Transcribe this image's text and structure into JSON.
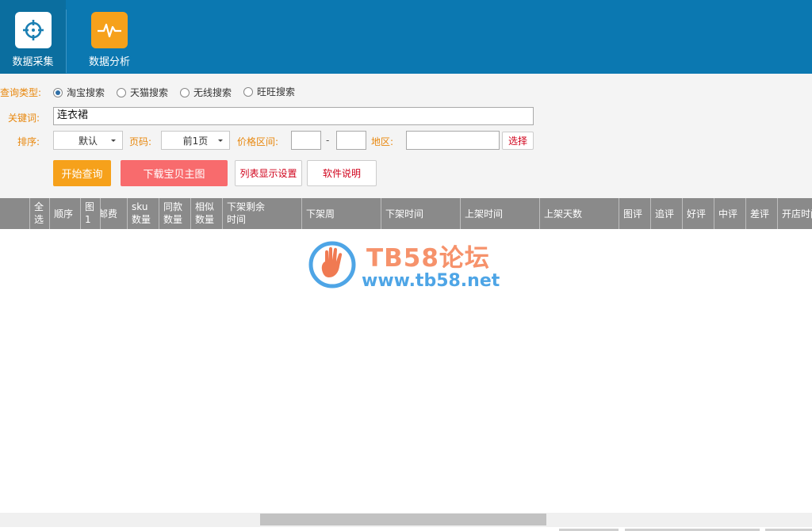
{
  "nav": {
    "collect_label": "数据采集",
    "analysis_label": "数据分析"
  },
  "form": {
    "query_type_label": "查询类型:",
    "query_types": [
      {
        "label": "淘宝搜索",
        "checked": true
      },
      {
        "label": "天猫搜索",
        "checked": false
      },
      {
        "label": "无线搜索",
        "checked": false
      },
      {
        "label": "旺旺搜索",
        "checked": false
      }
    ],
    "keyword_label": "关键词:",
    "keyword_value": "连衣裙",
    "sort_label": "排序:",
    "sort_value": "默认",
    "page_label": "页码:",
    "page_value": "前1页",
    "price_label": "价格区间:",
    "price_min": "",
    "price_max": "",
    "price_dash": "-",
    "region_label": "地区:",
    "region_value": "",
    "select_button": "选择"
  },
  "buttons": {
    "start_query": "开始查询",
    "download_images": "下载宝贝主图",
    "column_settings": "列表显示设置",
    "software_help": "软件说明"
  },
  "columns": [
    {
      "text": ""
    },
    {
      "text": "全选"
    },
    {
      "text": "顺序"
    },
    {
      "text": "图1"
    },
    {
      "text": "邮费"
    },
    {
      "text": "sku数量"
    },
    {
      "text": "同款数量"
    },
    {
      "text": "相似数量"
    },
    {
      "text": "下架剩余时间"
    },
    {
      "text": "下架周"
    },
    {
      "text": "下架时间"
    },
    {
      "text": "上架时间"
    },
    {
      "text": "上架天数"
    },
    {
      "text": "图评"
    },
    {
      "text": "追评"
    },
    {
      "text": "好评"
    },
    {
      "text": "中评"
    },
    {
      "text": "差评"
    },
    {
      "text": "开店时间"
    }
  ],
  "watermark": {
    "title": "TB58论坛",
    "url": "www.tb58.net"
  },
  "colors": {
    "topbar": "#0b78b1",
    "label_orange": "#e8870d",
    "btn_orange": "#f6a11b",
    "btn_red": "#f86b6d",
    "grid_header": "#8a8a8a"
  },
  "icons": {
    "collect": "crosshair-icon",
    "analysis": "pulse-icon"
  }
}
